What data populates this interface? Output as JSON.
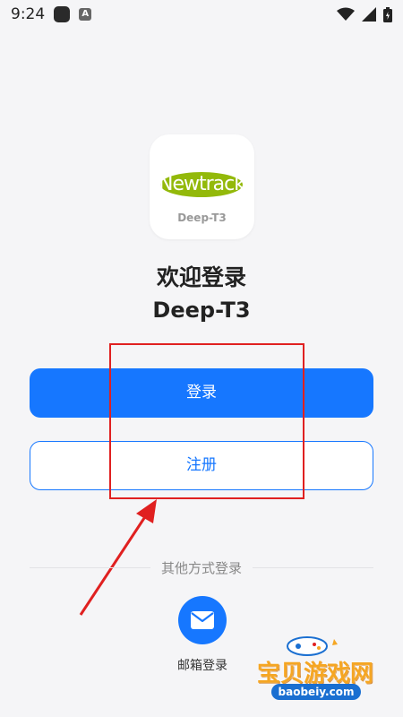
{
  "status_bar": {
    "time": "9:24",
    "icons": [
      "app-square-icon",
      "a-icon",
      "wifi-icon",
      "signal-icon",
      "battery-icon"
    ]
  },
  "logo": {
    "brand_text": "Newtrack",
    "model_text": "Deep-T3",
    "brand_color": "#93b90a"
  },
  "welcome": {
    "title": "欢迎登录",
    "app_name": "Deep-T3"
  },
  "buttons": {
    "login_label": "登录",
    "register_label": "注册"
  },
  "other_methods": {
    "divider_text": "其他方式登录",
    "email_label": "邮箱登录",
    "email_icon": "mail-icon"
  },
  "watermark": {
    "site_name": "宝贝游戏网",
    "url": "baobeiy.com"
  },
  "colors": {
    "accent": "#1677ff",
    "annotation": "#e02020",
    "background": "#f5f5f7"
  }
}
